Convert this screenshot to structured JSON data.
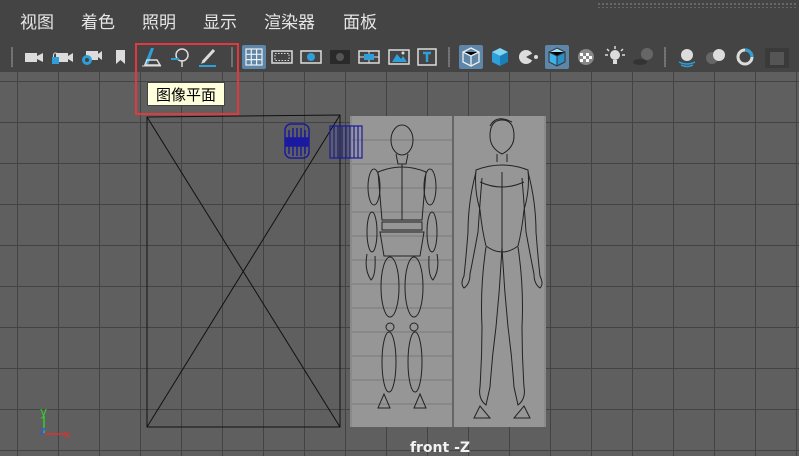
{
  "menubar": {
    "items": [
      "视图",
      "着色",
      "照明",
      "显示",
      "渲染器",
      "面板"
    ]
  },
  "toolbar": {
    "icons": [
      "camera-icon",
      "camera-lock-icon",
      "camera-attributes-icon",
      "bookmark-icon",
      "image-plane-icon",
      "grease-pencil-icon",
      "pencil-icon",
      "grid-icon",
      "film-gate-icon",
      "resolution-gate-icon",
      "gate-mask-icon",
      "field-chart-icon",
      "safe-action-icon",
      "safe-title-icon",
      "wireframe-icon",
      "smooth-shade-icon",
      "default-material-icon",
      "wireframe-on-shaded-icon",
      "xray-icon",
      "lights-icon",
      "shadows-icon",
      "screen-space-ao-icon",
      "motion-blur-icon",
      "anti-aliasing-icon",
      "isolate-select-icon"
    ]
  },
  "tooltip": {
    "text": "图像平面"
  },
  "viewport": {
    "camera_label": "front -Z",
    "axis": {
      "y": "y",
      "z": "z",
      "x": "x"
    }
  },
  "colors": {
    "highlight": "#e0393e",
    "axis_x": "#e03030",
    "axis_y": "#30d030",
    "axis_z": "#3050ff",
    "selection": "#5e86a8"
  }
}
